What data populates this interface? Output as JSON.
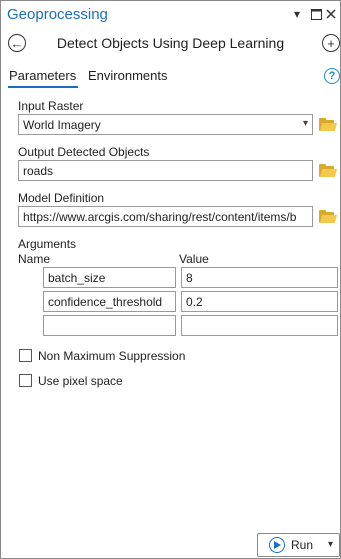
{
  "pane": {
    "title": "Geoprocessing",
    "tool_title": "Detect Objects Using Deep Learning"
  },
  "tabs": [
    {
      "label": "Parameters",
      "active": true
    },
    {
      "label": "Environments",
      "active": false
    }
  ],
  "params": {
    "input_raster": {
      "label": "Input Raster",
      "value": "World Imagery"
    },
    "output": {
      "label": "Output Detected Objects",
      "value": "roads"
    },
    "model": {
      "label": "Model Definition",
      "value": "https://www.arcgis.com/sharing/rest/content/items/b"
    }
  },
  "arguments": {
    "label": "Arguments",
    "col_name": "Name",
    "col_value": "Value",
    "rows": [
      {
        "name": "batch_size",
        "value": "8"
      },
      {
        "name": "confidence_threshold",
        "value": "0.2"
      },
      {
        "name": "",
        "value": ""
      }
    ]
  },
  "checkboxes": [
    {
      "label": "Non Maximum Suppression",
      "checked": false
    },
    {
      "label": "Use pixel space",
      "checked": false
    }
  ],
  "run": {
    "label": "Run"
  },
  "colors": {
    "accent": "#1a6fc0",
    "folder": "#f2c94c"
  }
}
